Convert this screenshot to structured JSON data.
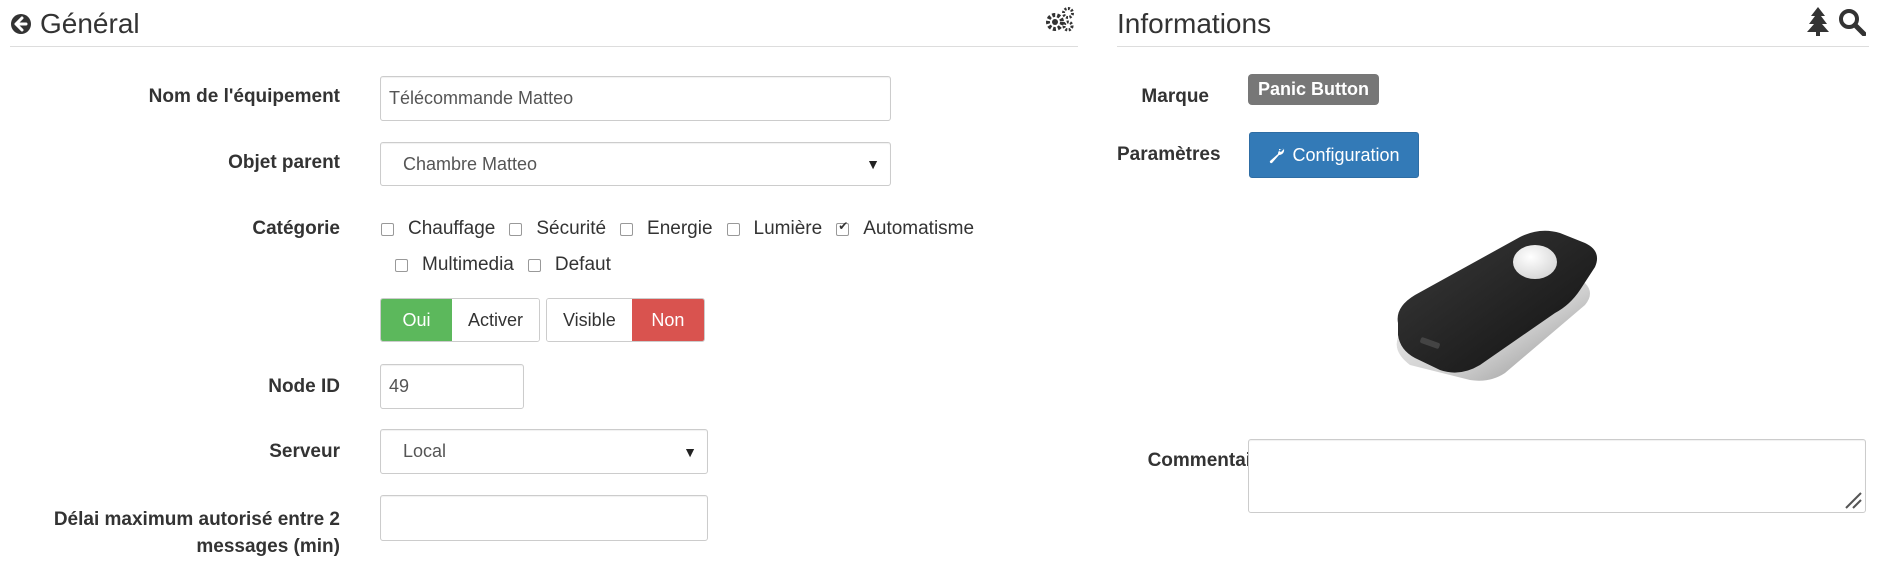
{
  "general": {
    "title": "Général",
    "back_icon": "arrow-circle-left-icon",
    "settings_icon": "gears-icon",
    "fields": {
      "name_label": "Nom de l'équipement",
      "name_value": "Télécommande Matteo",
      "parent_label": "Objet parent",
      "parent_value": "Chambre Matteo",
      "category_label": "Catégorie",
      "categories": [
        {
          "label": "Chauffage",
          "checked": false
        },
        {
          "label": "Sécurité",
          "checked": false
        },
        {
          "label": "Energie",
          "checked": false
        },
        {
          "label": "Lumière",
          "checked": false
        },
        {
          "label": "Automatisme",
          "checked": true
        },
        {
          "label": "Multimedia",
          "checked": false
        },
        {
          "label": "Defaut",
          "checked": false
        }
      ],
      "activate_yes": "Oui",
      "activate_label": "Activer",
      "visible_label": "Visible",
      "visible_no": "Non",
      "nodeid_label": "Node ID",
      "nodeid_value": "49",
      "server_label": "Serveur",
      "server_value": "Local",
      "delay_label_line1": "Délai maximum autorisé entre 2",
      "delay_label_line2": "messages (min)",
      "delay_value": ""
    }
  },
  "info": {
    "title": "Informations",
    "tree_icon": "tree-icon",
    "search_icon": "search-icon",
    "brand_label": "Marque",
    "brand_value": "Panic Button",
    "params_label": "Paramètres",
    "config_button": "Configuration",
    "config_icon": "wrench-icon",
    "comment_label": "Commentaire",
    "comment_value": ""
  },
  "colors": {
    "green": "#5cb85c",
    "red": "#d9534f",
    "primary": "#337ab7",
    "badge": "#777777"
  }
}
